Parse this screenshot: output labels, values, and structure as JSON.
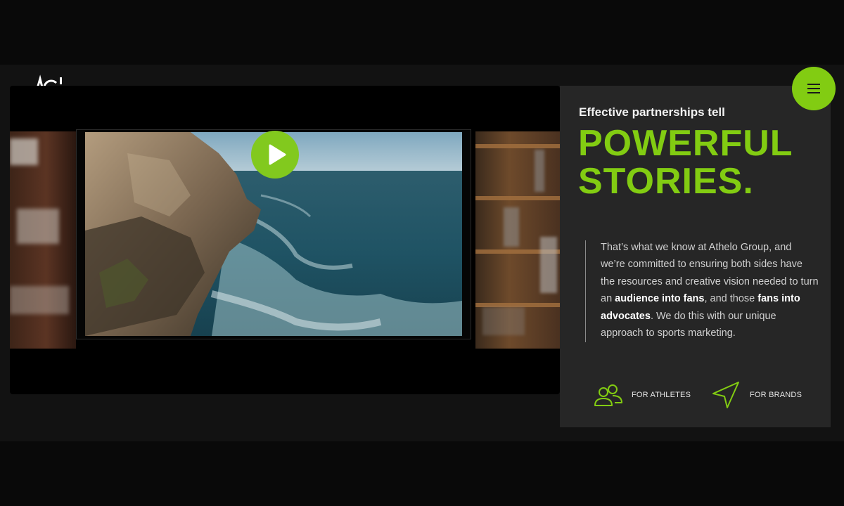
{
  "brand": {
    "logo_icon": "athelo-group-logo",
    "accent_color": "#82cc12"
  },
  "nav": {
    "menu_icon": "hamburger-menu-icon"
  },
  "video": {
    "play_icon": "play-icon",
    "scene": "rocky-coastline-ocean-waves"
  },
  "hero": {
    "eyebrow": "Effective partnerships tell",
    "headline_line1": "POWERFUL",
    "headline_line2": "STORIES.",
    "body": {
      "part1": "That’s what we know at Athelo Group, and we’re committed to ensuring both sides have the resources and creative vision needed to turn an ",
      "bold1": "audience into fans",
      "part2": ", and those ",
      "bold2": "fans into advocates",
      "part3": ". We do this with our unique approach to sports marketing."
    }
  },
  "links": {
    "athletes_label": "FOR ATHLETES",
    "athletes_icon": "users-icon",
    "brands_label": "FOR BRANDS",
    "brands_icon": "navigation-arrow-icon"
  }
}
